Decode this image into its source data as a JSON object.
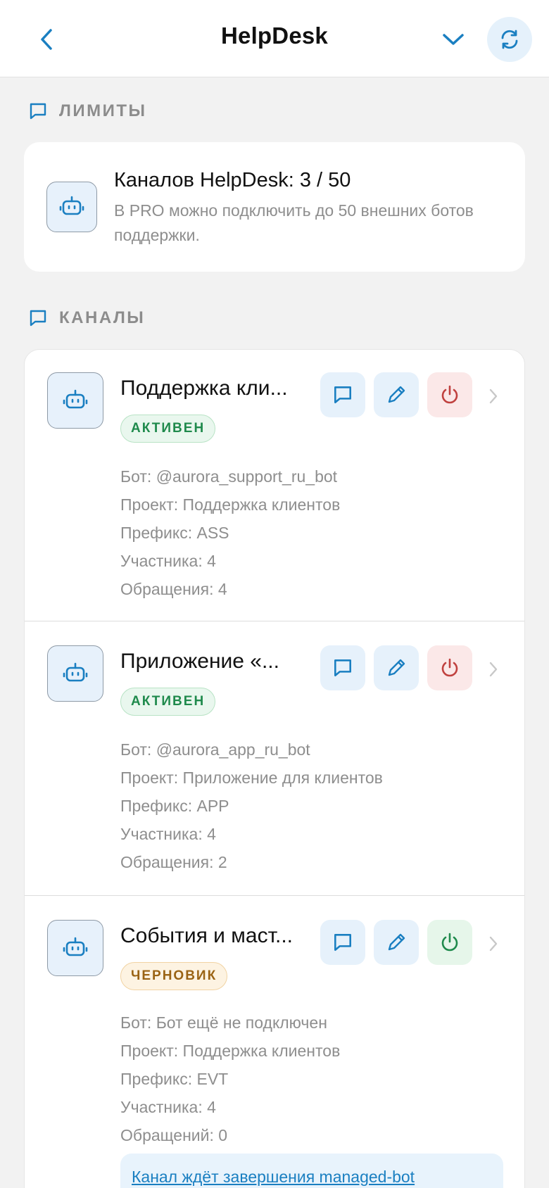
{
  "header": {
    "title": "HelpDesk",
    "back_icon": "chevron-left-icon",
    "collapse_icon": "chevron-down-icon",
    "refresh_icon": "refresh-icon"
  },
  "limits": {
    "section_label": "ЛИМИТЫ",
    "title": "Каналов HelpDesk: 3 / 50",
    "description": "В PRO можно подключить до 50 внешних ботов поддержки."
  },
  "channels_section": {
    "section_label": "КАНАЛЫ",
    "items": [
      {
        "name": "Поддержка кли...",
        "status": "АКТИВЕН",
        "status_type": "active",
        "bot": "Бот: @aurora_support_ru_bot",
        "project": "Проект: Поддержка клиентов",
        "prefix": "Префикс: ASS",
        "members": "Участника: 4",
        "tickets": "Обращения: 4",
        "power_state": "on"
      },
      {
        "name": "Приложение «...",
        "status": "АКТИВЕН",
        "status_type": "active",
        "bot": "Бот: @aurora_app_ru_bot",
        "project": "Проект: Приложение для клиентов",
        "prefix": "Префикс: APP",
        "members": "Участника: 4",
        "tickets": "Обращения: 2",
        "power_state": "on"
      },
      {
        "name": "События и маст...",
        "status": "ЧЕРНОВИК",
        "status_type": "draft",
        "bot": "Бот: Бот ещё не подключен",
        "project": "Проект: Поддержка клиентов",
        "prefix": "Префикс: EVT",
        "members": "Участника: 4",
        "tickets": "Обращений: 0",
        "power_state": "off",
        "notice": "Канал ждёт завершения managed-bot"
      }
    ]
  },
  "colors": {
    "accent": "#1a7fc1",
    "active_green": "#1f8a4c",
    "draft_amber": "#9a6314",
    "danger_red": "#c0413f",
    "muted_text": "#8e8e8e"
  }
}
